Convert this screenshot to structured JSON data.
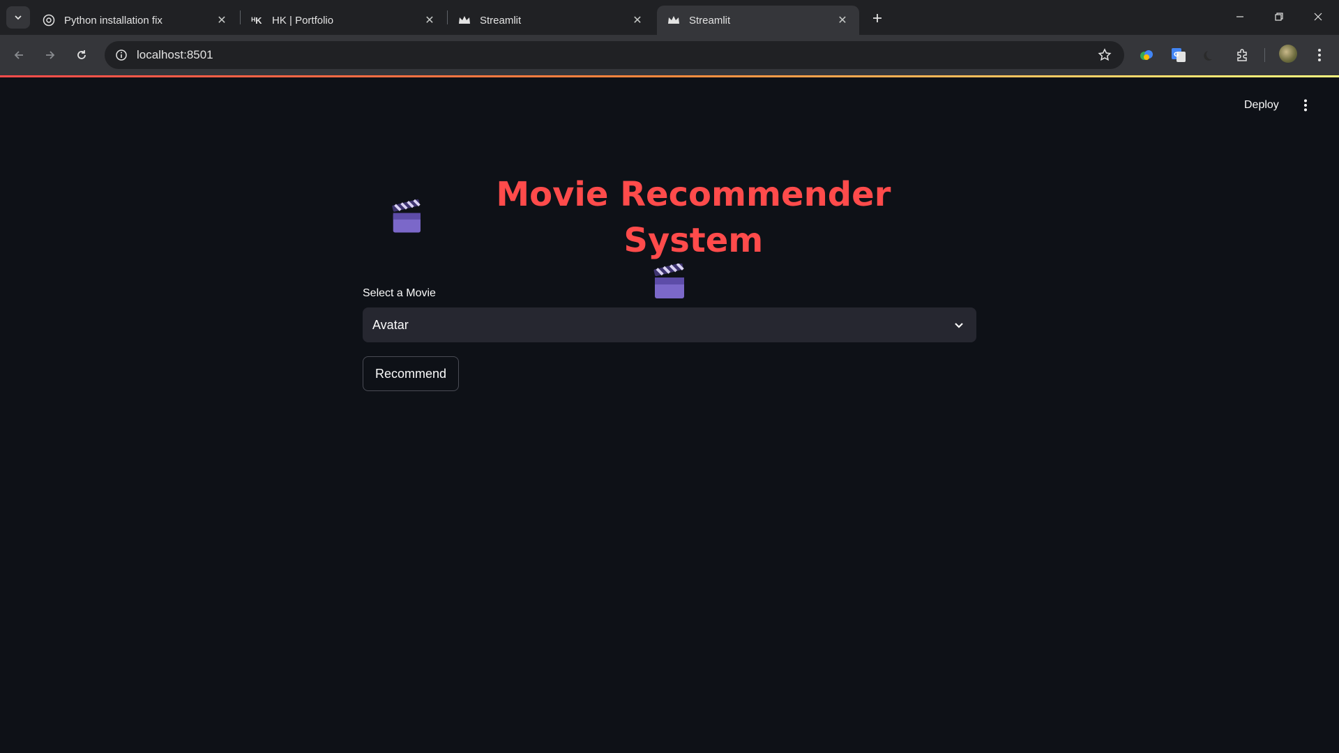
{
  "browser": {
    "tabs": [
      {
        "title": "Python installation fix",
        "icon": "openai-icon",
        "active": false
      },
      {
        "title": "HK | Portfolio",
        "icon": "hk-logo-icon",
        "active": false
      },
      {
        "title": "Streamlit",
        "icon": "streamlit-crown-icon",
        "active": false
      },
      {
        "title": "Streamlit",
        "icon": "streamlit-crown-icon",
        "active": true
      }
    ],
    "url": "localhost:8501"
  },
  "app": {
    "header": {
      "deploy_label": "Deploy"
    },
    "title": "Movie Recommender System",
    "title_emoji": "clapperboard-icon",
    "select": {
      "label": "Select a Movie",
      "value": "Avatar"
    },
    "recommend_label": "Recommend"
  },
  "colors": {
    "title": "#ff4b4b",
    "background": "#0e1117",
    "select_bg": "#262730"
  }
}
